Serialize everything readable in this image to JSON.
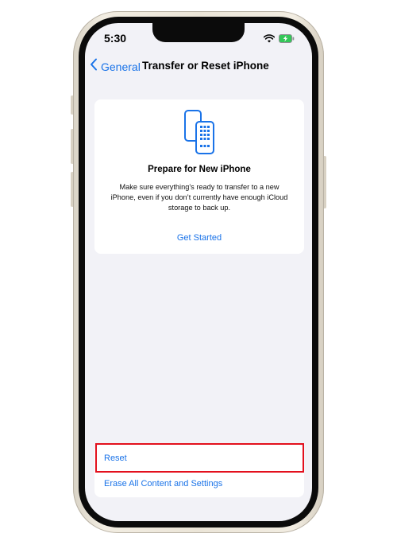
{
  "status_bar": {
    "time": "5:30"
  },
  "nav": {
    "back_label": "General",
    "title": "Transfer or Reset iPhone"
  },
  "prepare_card": {
    "title": "Prepare for New iPhone",
    "description": "Make sure everything’s ready to transfer to a new iPhone, even if you don’t currently have enough iCloud storage to back up.",
    "action_label": "Get Started",
    "icon": "two-phones-icon"
  },
  "reset_group": {
    "reset_label": "Reset",
    "erase_label": "Erase All Content and Settings"
  },
  "colors": {
    "accent": "#1a73e8",
    "screen_background": "#f2f2f7",
    "highlight": "#e3101d"
  }
}
